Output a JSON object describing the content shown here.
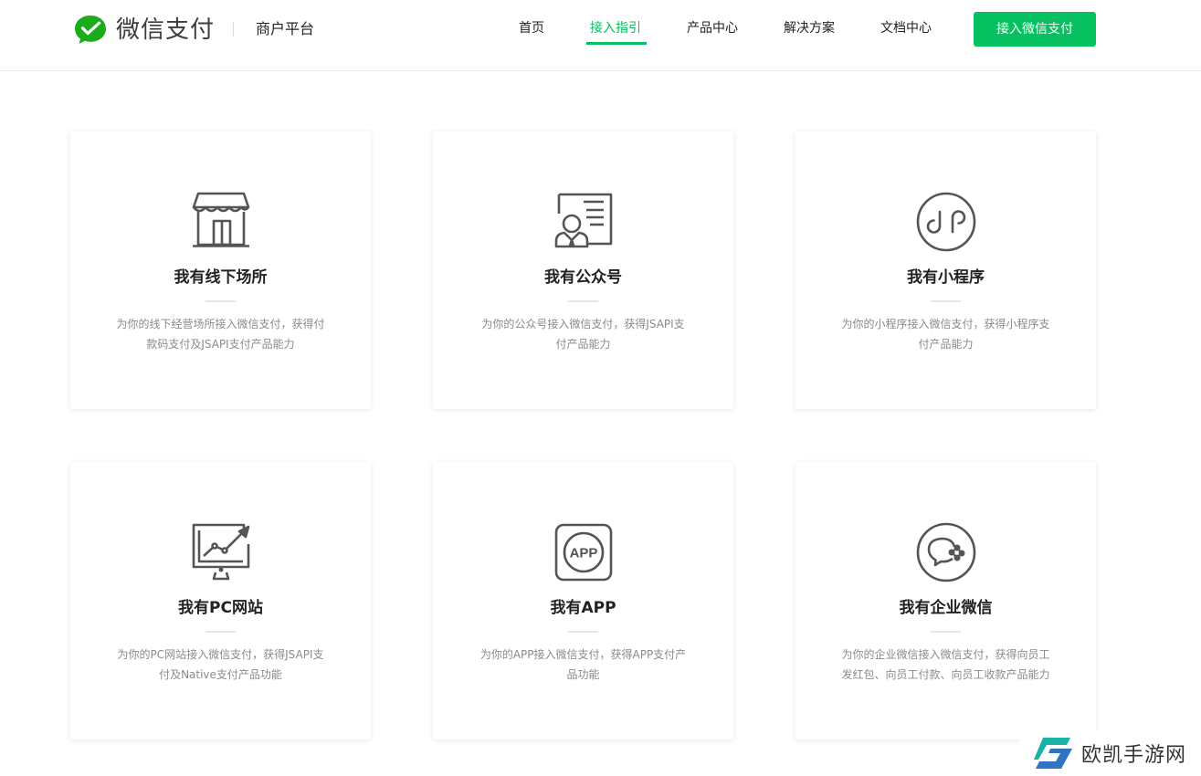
{
  "header": {
    "brand": "微信支付",
    "merchant_label": "商户平台",
    "nav": [
      {
        "label": "首页"
      },
      {
        "label": "接入指引"
      },
      {
        "label": "产品中心"
      },
      {
        "label": "解决方案"
      },
      {
        "label": "文档中心"
      }
    ],
    "active_nav": "接入指引",
    "cta_label": "接入微信支付",
    "accent_color": "#07c160"
  },
  "cards": [
    {
      "icon": "storefront-icon",
      "title": "我有线下场所",
      "desc": "为你的线下经营场所接入微信支付，获得付款码支付及JSAPI支付产品能力"
    },
    {
      "icon": "official-account-icon",
      "title": "我有公众号",
      "desc": "为你的公众号接入微信支付，获得JSAPI支付产品能力"
    },
    {
      "icon": "mini-program-icon",
      "title": "我有小程序",
      "desc": "为你的小程序接入微信支付，获得小程序支付产品能力"
    },
    {
      "icon": "pc-website-icon",
      "title": "我有PC网站",
      "desc": "为你的PC网站接入微信支付，获得JSAPI支付及Native支付产品功能"
    },
    {
      "icon": "app-icon",
      "title": "我有APP",
      "app_glyph": "APP",
      "desc": "为你的APP接入微信支付，获得APP支付产品功能"
    },
    {
      "icon": "wecom-icon",
      "title": "我有企业微信",
      "desc": "为你的企业微信接入微信支付，获得向员工发红包、向员工付款、向员工收款产品能力"
    }
  ],
  "watermark": {
    "text": "欧凯手游网"
  }
}
